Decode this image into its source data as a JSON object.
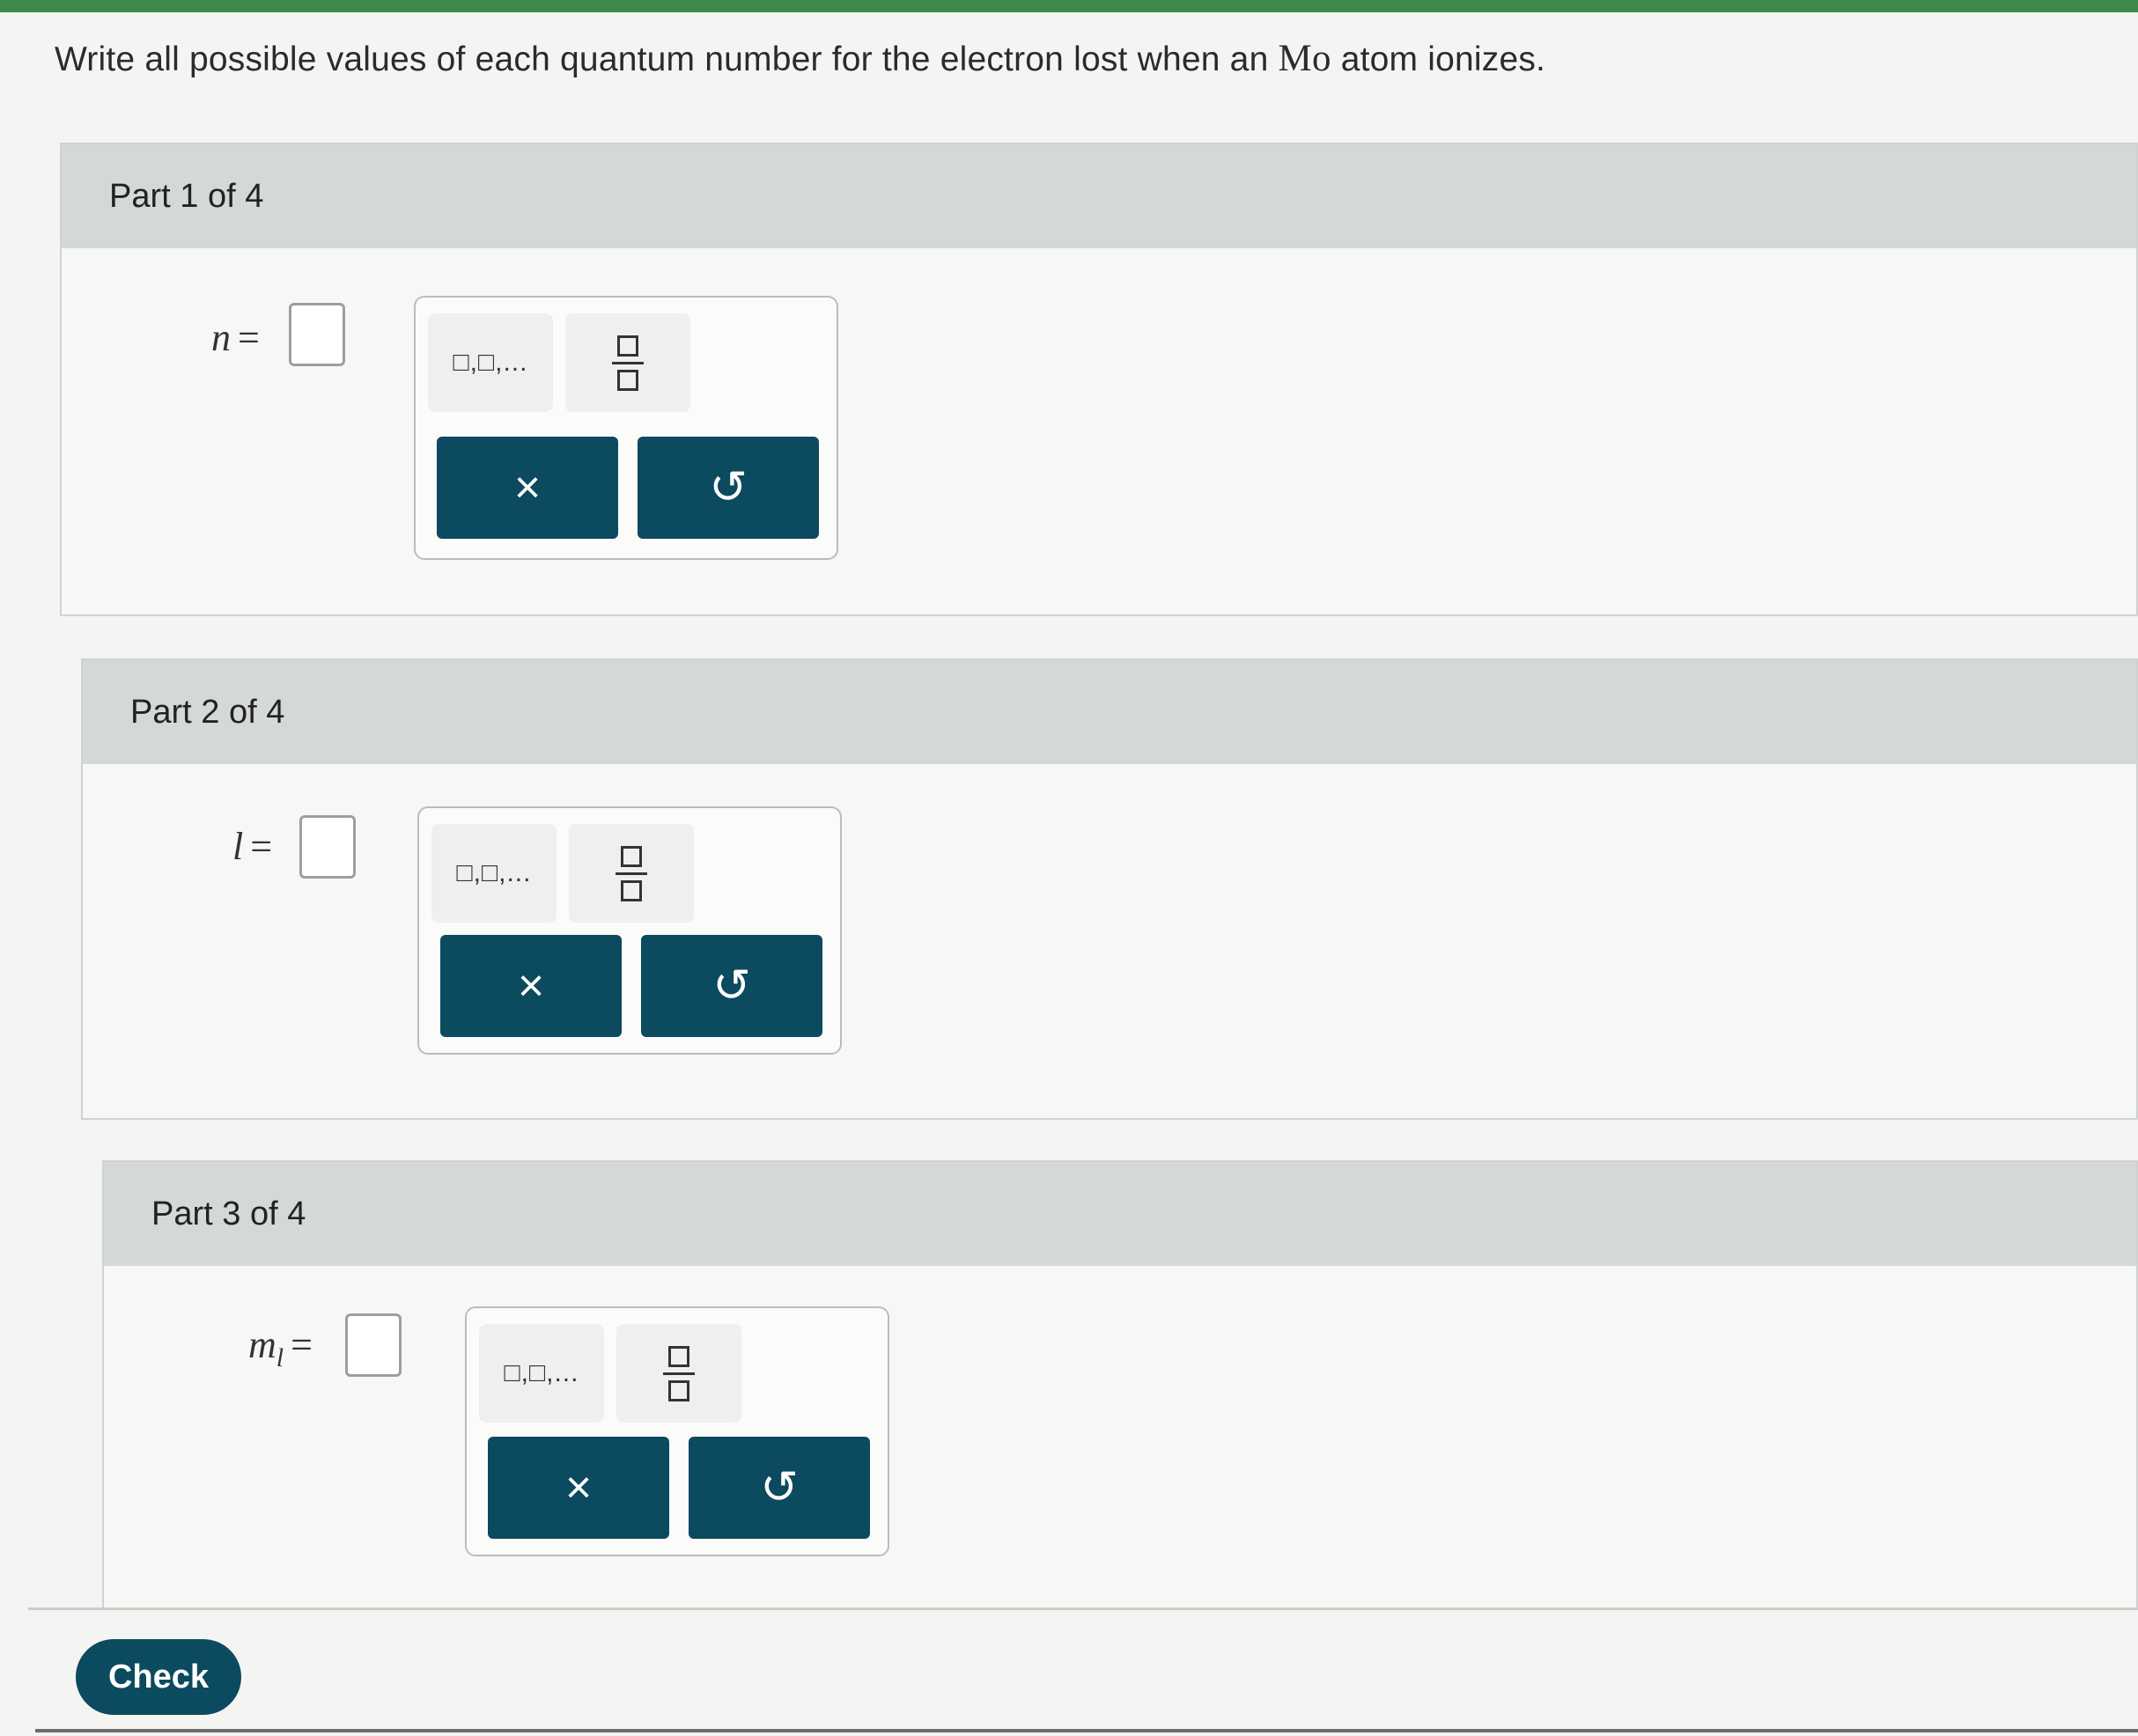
{
  "question": {
    "prefix": "Write all possible values of each quantum number for the electron lost when an ",
    "element": "Mo",
    "suffix": " atom ionizes."
  },
  "parts": [
    {
      "header": "Part 1 of 4",
      "var": "n",
      "sub": "",
      "eq": "="
    },
    {
      "header": "Part 2 of 4",
      "var": "l",
      "sub": "",
      "eq": "="
    },
    {
      "header": "Part 3 of 4",
      "var": "m",
      "sub": "l",
      "eq": "="
    }
  ],
  "toolbox": {
    "list_glyph": "□,□,...",
    "clear_glyph": "×",
    "undo_glyph": "↺"
  },
  "check_label": "Check",
  "colors": {
    "button": "#0c4a5f",
    "header": "#d5d9d6",
    "accent_strip": "#3f8a4a"
  },
  "icons": [
    "list-template-icon",
    "fraction-template-icon",
    "clear-icon",
    "undo-icon"
  ]
}
